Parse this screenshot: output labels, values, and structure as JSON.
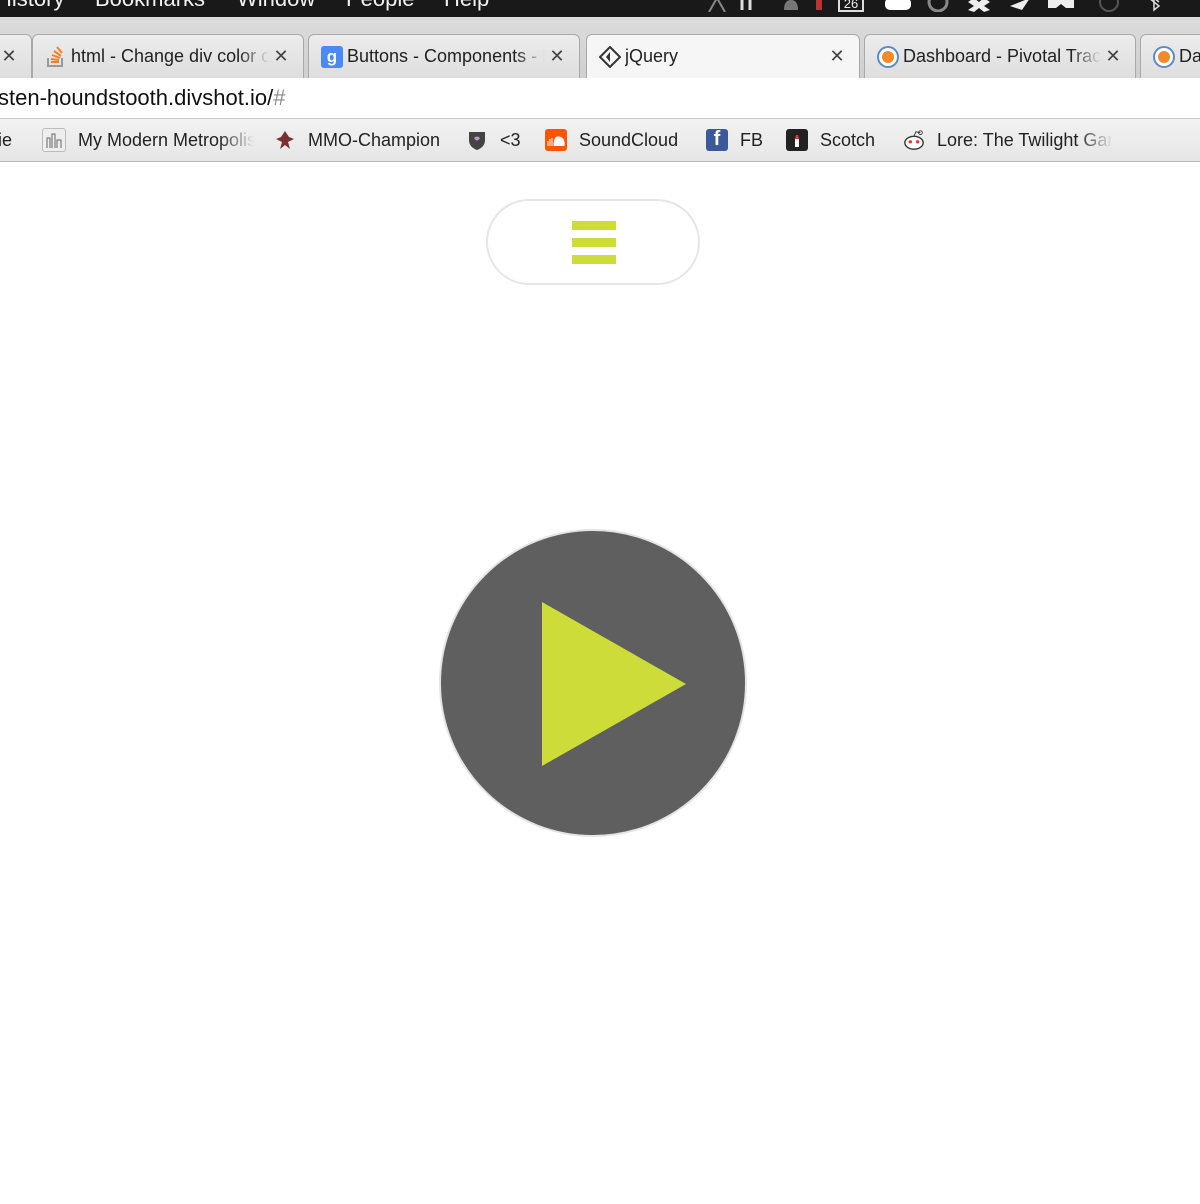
{
  "colors": {
    "accent": "#cddc39",
    "play_circle": "#5f5f5f",
    "menubar": "#191919"
  },
  "menubar": {
    "items": [
      "History",
      "Bookmarks",
      "Window",
      "People",
      "Help"
    ],
    "clock_badge": "26"
  },
  "tabs": [
    {
      "title": "",
      "favicon": "none"
    },
    {
      "title": "html - Change div color on",
      "favicon": "stackoverflow-icon"
    },
    {
      "title": "Buttons - Components - Bootstrap",
      "favicon": "google-icon"
    },
    {
      "title": "jQuery",
      "favicon": "jquery-icon",
      "active": true
    },
    {
      "title": "Dashboard - Pivotal Tracker",
      "favicon": "pivotal-icon"
    },
    {
      "title": "Da",
      "favicon": "pivotal-icon"
    }
  ],
  "address": {
    "url": "sten-houndstooth.divshot.io/",
    "hash": "#"
  },
  "bookmarks": [
    {
      "label": "ie",
      "icon": "none"
    },
    {
      "label": "My Modern Metropolis",
      "icon": "metropolis-icon"
    },
    {
      "label": "MMO-Champion",
      "icon": "mmo-icon"
    },
    {
      "label": "<3",
      "icon": "shield-icon"
    },
    {
      "label": "SoundCloud",
      "icon": "soundcloud-icon"
    },
    {
      "label": "FB",
      "icon": "facebook-icon"
    },
    {
      "label": "Scotch",
      "icon": "scotch-icon"
    },
    {
      "label": "Lore: The Twilight Garden",
      "icon": "reddit-icon"
    }
  ],
  "page": {
    "menu_icon": "hamburger-icon",
    "play_icon": "play-icon"
  }
}
